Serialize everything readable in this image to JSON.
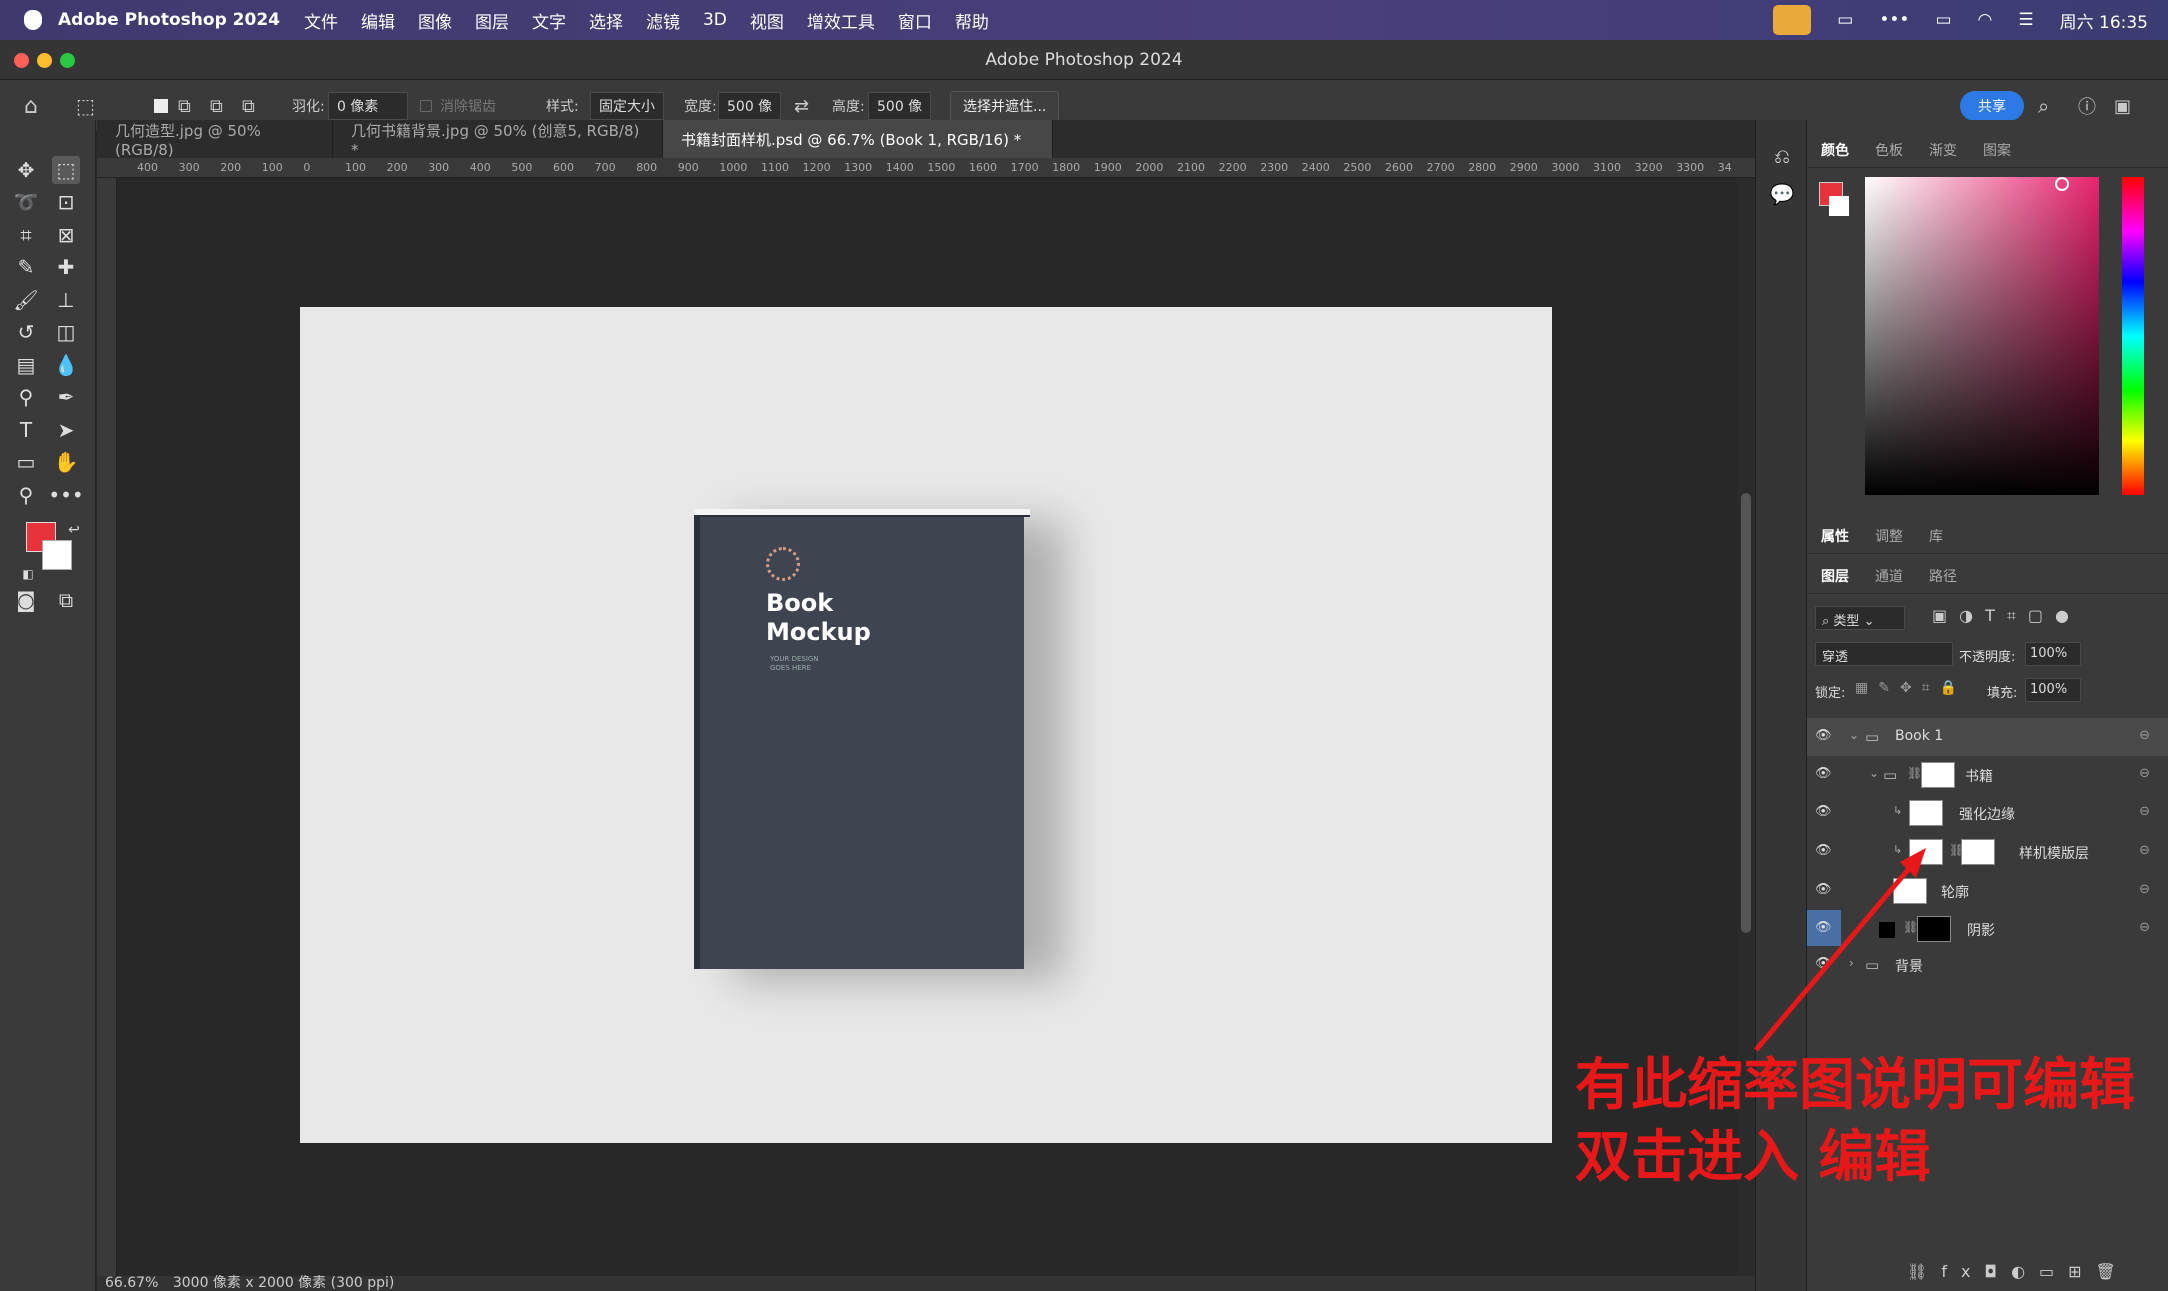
{
  "menubar": {
    "app_name": "Adobe Photoshop 2024",
    "menus": [
      "文件",
      "编辑",
      "图像",
      "图层",
      "文字",
      "选择",
      "滤镜",
      "3D",
      "视图",
      "增效工具",
      "窗口",
      "帮助"
    ],
    "clock": "周六 16:35"
  },
  "window": {
    "title": "Adobe Photoshop 2024"
  },
  "options": {
    "feather_label": "羽化:",
    "feather_value": "0 像素",
    "antialias_label": "消除锯齿",
    "style_label": "样式:",
    "style_value": "固定大小",
    "width_label": "宽度:",
    "width_value": "500 像",
    "height_label": "高度:",
    "height_value": "500 像",
    "select_mask": "选择并遮住...",
    "share": "共享"
  },
  "tabs": [
    {
      "label": "几何造型.jpg @ 50%(RGB/8)"
    },
    {
      "label": "几何书籍背景.jpg @ 50% (创意5, RGB/8) *"
    },
    {
      "label": "书籍封面样机.psd @ 66.7% (Book 1, RGB/16) *"
    }
  ],
  "ruler_ticks": [
    "400",
    "300",
    "200",
    "100",
    "0",
    "100",
    "200",
    "300",
    "400",
    "500",
    "600",
    "700",
    "800",
    "900",
    "1000",
    "1100",
    "1200",
    "1300",
    "1400",
    "1500",
    "1600",
    "1700",
    "1800",
    "1900",
    "2000",
    "2100",
    "2200",
    "2300",
    "2400",
    "2500",
    "2600",
    "2700",
    "2800",
    "2900",
    "3000",
    "3100",
    "3200",
    "3300",
    "34"
  ],
  "book": {
    "title_line1": "Book",
    "title_line2": "Mockup",
    "small_text": "YOUR DESIGN GOES HERE"
  },
  "status": {
    "zoom": "66.67%",
    "info": "3000 像素 x 2000 像素 (300 ppi)"
  },
  "color_panel": {
    "tabs": [
      "颜色",
      "色板",
      "渐变",
      "图案"
    ],
    "foreground": "#e8323c",
    "background": "#ffffff"
  },
  "props_panel": {
    "tabs": [
      "属性",
      "调整",
      "库"
    ]
  },
  "layers_panel": {
    "tabs": [
      "图层",
      "通道",
      "路径"
    ],
    "filter_label": "类型",
    "blend_mode": "穿透",
    "opacity_label": "不透明度:",
    "opacity_value": "100%",
    "lock_label": "锁定:",
    "fill_label": "填充:",
    "fill_value": "100%",
    "layers": [
      {
        "name": "Book 1"
      },
      {
        "name": "书籍"
      },
      {
        "name": "强化边缘"
      },
      {
        "name": "样机模版层"
      },
      {
        "name": "轮廓"
      },
      {
        "name": "阴影"
      },
      {
        "name": "背景"
      }
    ]
  },
  "annotation": {
    "line1": "有此缩率图说明可编辑",
    "line2": "双击进入 编辑"
  }
}
